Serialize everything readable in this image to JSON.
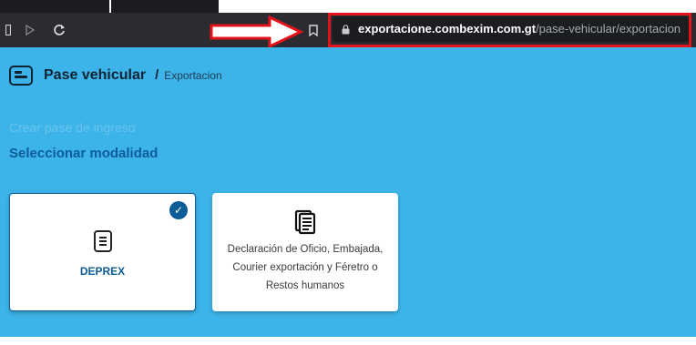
{
  "browser": {
    "url_domain": "exportacione.combexim.com.gt",
    "url_path": "/pase-vehicular/exportacion",
    "icons": [
      "sidebar-icon",
      "forward-icon",
      "reload-icon",
      "bookmark-icon",
      "lock-icon"
    ],
    "annotation_color": "#e3121b"
  },
  "page": {
    "background": "#3db4e9",
    "breadcrumb": {
      "title": "Pase vehicular",
      "separator": "/",
      "current": "Exportacion"
    },
    "subtitle_faded": "Crear pase de ingreso",
    "section_title": "Seleccionar modalidad",
    "cards": [
      {
        "label": "DEPREX",
        "selected": true,
        "icon": "document-icon"
      },
      {
        "label": "Declaración de Oficio, Embajada,\nCourier exportación y Féretro o\nRestos humanos",
        "selected": false,
        "icon": "clipboard-document-icon"
      }
    ]
  }
}
